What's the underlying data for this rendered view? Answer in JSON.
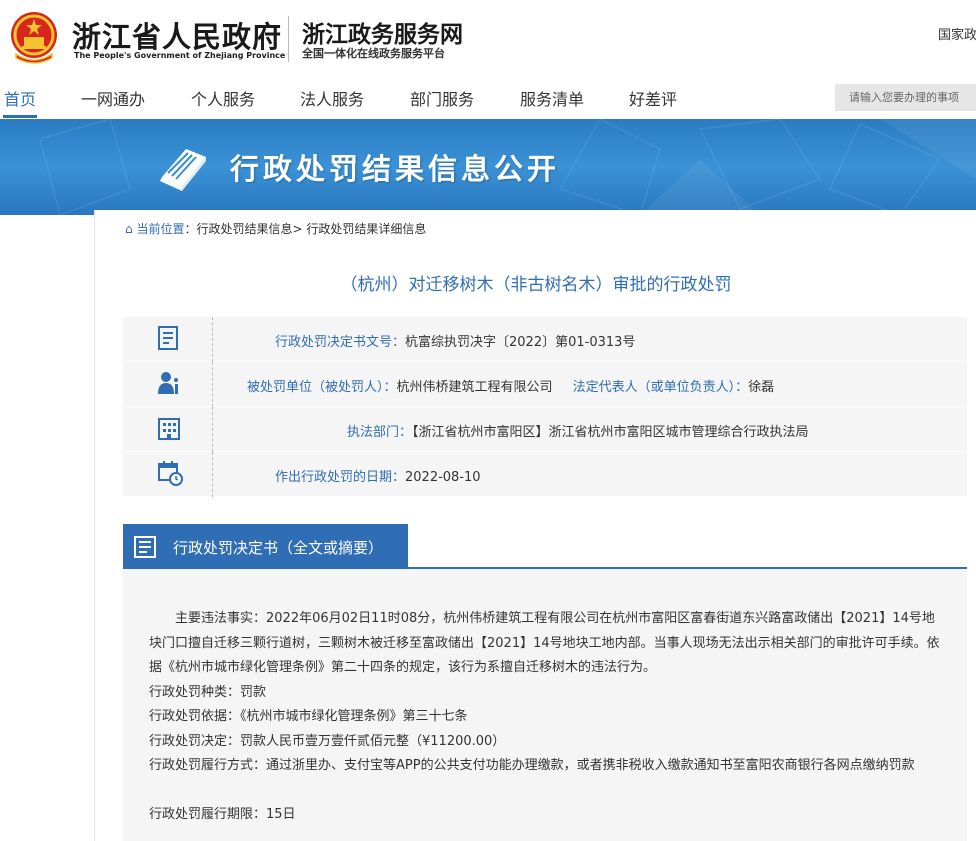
{
  "header": {
    "gov_title": "浙江省人民政府",
    "gov_subtitle": "The People's Government of Zhejiang Province",
    "service_title": "浙江政务服务网",
    "service_subtitle": "全国一体化在线政务服务平台",
    "top_link": "国家政"
  },
  "nav": {
    "items": [
      {
        "label": "首页"
      },
      {
        "label": "一网通办"
      },
      {
        "label": "个人服务"
      },
      {
        "label": "法人服务"
      },
      {
        "label": "部门服务"
      },
      {
        "label": "服务清单"
      },
      {
        "label": "好差评"
      }
    ],
    "search_placeholder": "请输入您要办理的事项"
  },
  "banner": {
    "title": "行政处罚结果信息公开"
  },
  "breadcrumb": {
    "home": "当前位置",
    "path": "：行政处罚结果信息> 行政处罚结果详细信息"
  },
  "page_title": "（杭州）对迁移树木（非古树名木）审批的行政处罚",
  "info": {
    "doc_no_label": "行政处罚决定书文号：",
    "doc_no": "杭富综执罚决字〔2022〕第01-0313号",
    "party_label": "被处罚单位（被处罚人）：",
    "party": "杭州伟桥建筑工程有限公司",
    "rep_label": "法定代表人（或单位负责人）：",
    "rep": "徐磊",
    "dept_label": "执法部门：",
    "dept": "【浙江省杭州市富阳区】浙江省杭州市富阳区城市管理综合行政执法局",
    "date_label": "作出行政处罚的日期：",
    "date": "2022-08-10"
  },
  "section_title": "行政处罚决定书（全文或摘要）",
  "decision": {
    "facts": "主要违法事实：2022年06月02日11时08分，杭州伟桥建筑工程有限公司在杭州市富阳区富春街道东兴路富政储出【2021】14号地块门口擅自迁移三颗行道树，三颗树木被迁移至富政储出【2021】14号地块工地内部。当事人现场无法出示相关部门的审批许可手续。依据《杭州市城市绿化管理条例》第二十四条的规定，该行为系擅自迁移树木的违法行为。",
    "type": "行政处罚种类：罚款",
    "basis": "行政处罚依据：《杭州市城市绿化管理条例》第三十七条",
    "result": "行政处罚决定：罚款人民币壹万壹仟贰佰元整（¥11200.00）",
    "method": "行政处罚履行方式：通过浙里办、支付宝等APP的公共支付功能办理缴款，或者携非税收入缴款通知书至富阳农商银行各网点缴纳罚款",
    "deadline": "行政处罚履行期限：15日"
  }
}
